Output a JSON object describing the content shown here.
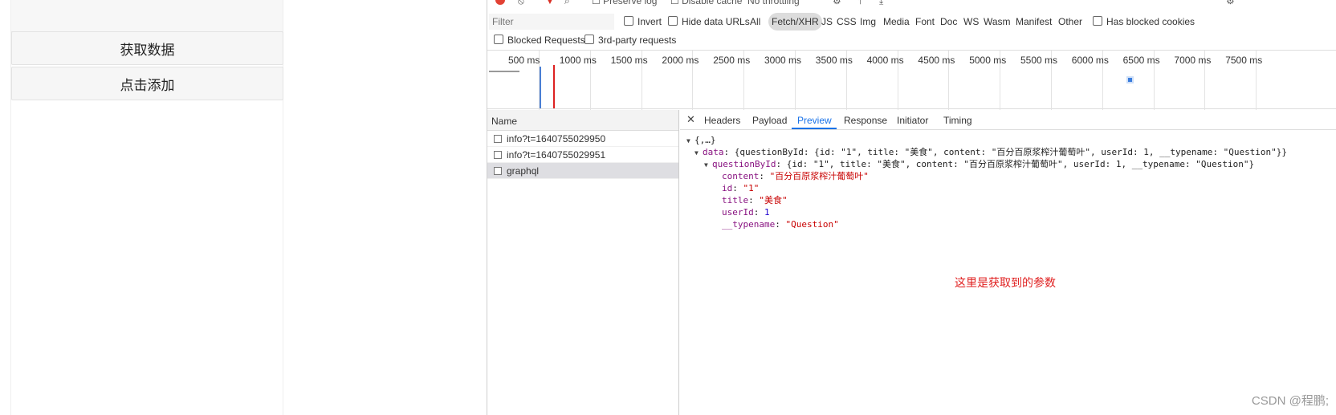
{
  "app": {
    "buttons": [
      "获取数据",
      "点击添加"
    ]
  },
  "devtools": {
    "toolbar": {
      "preserve_log": "Preserve log",
      "disable_cache": "Disable cache",
      "throttling": "No throttling"
    },
    "filter": {
      "placeholder": "Filter",
      "invert": "Invert",
      "hide_data_urls": "Hide data URLs",
      "types": [
        "All",
        "Fetch/XHR",
        "JS",
        "CSS",
        "Img",
        "Media",
        "Font",
        "Doc",
        "WS",
        "Wasm",
        "Manifest",
        "Other"
      ],
      "active_type": "Fetch/XHR",
      "has_blocked_cookies": "Has blocked cookies",
      "blocked_requests": "Blocked Requests",
      "third_party": "3rd-party requests"
    },
    "timeline": {
      "ticks": [
        "500 ms",
        "1000 ms",
        "1500 ms",
        "2000 ms",
        "2500 ms",
        "3000 ms",
        "3500 ms",
        "4000 ms",
        "4500 ms",
        "5000 ms",
        "5500 ms",
        "6000 ms",
        "6500 ms",
        "7000 ms",
        "7500 ms"
      ]
    },
    "requests": {
      "header": "Name",
      "items": [
        "info?t=1640755029950",
        "info?t=1640755029951",
        "graphql"
      ],
      "selected_index": 2
    },
    "detail": {
      "tabs": [
        "Headers",
        "Payload",
        "Preview",
        "Response",
        "Initiator",
        "Timing"
      ],
      "active_tab": "Preview",
      "preview": {
        "root": "{,…}",
        "data_line_key": "data",
        "data_line_val": "{questionById: {id: \"1\", title: \"美食\", content: \"百分百原浆榨汁葡萄叶\", userId: 1, __typename: \"Question\"}}",
        "qb_line_key": "questionById",
        "qb_line_val": "{id: \"1\", title: \"美食\", content: \"百分百原浆榨汁葡萄叶\", userId: 1, __typename: \"Question\"}",
        "fields": [
          {
            "key": "content",
            "value": "\"百分百原浆榨汁葡萄叶\"",
            "type": "str"
          },
          {
            "key": "id",
            "value": "\"1\"",
            "type": "str"
          },
          {
            "key": "title",
            "value": "\"美食\"",
            "type": "str"
          },
          {
            "key": "userId",
            "value": "1",
            "type": "num"
          },
          {
            "key": "__typename",
            "value": "\"Question\"",
            "type": "str"
          }
        ]
      },
      "annotation": "这里是获取到的参数"
    }
  },
  "watermark": "CSDN @程鹏;"
}
